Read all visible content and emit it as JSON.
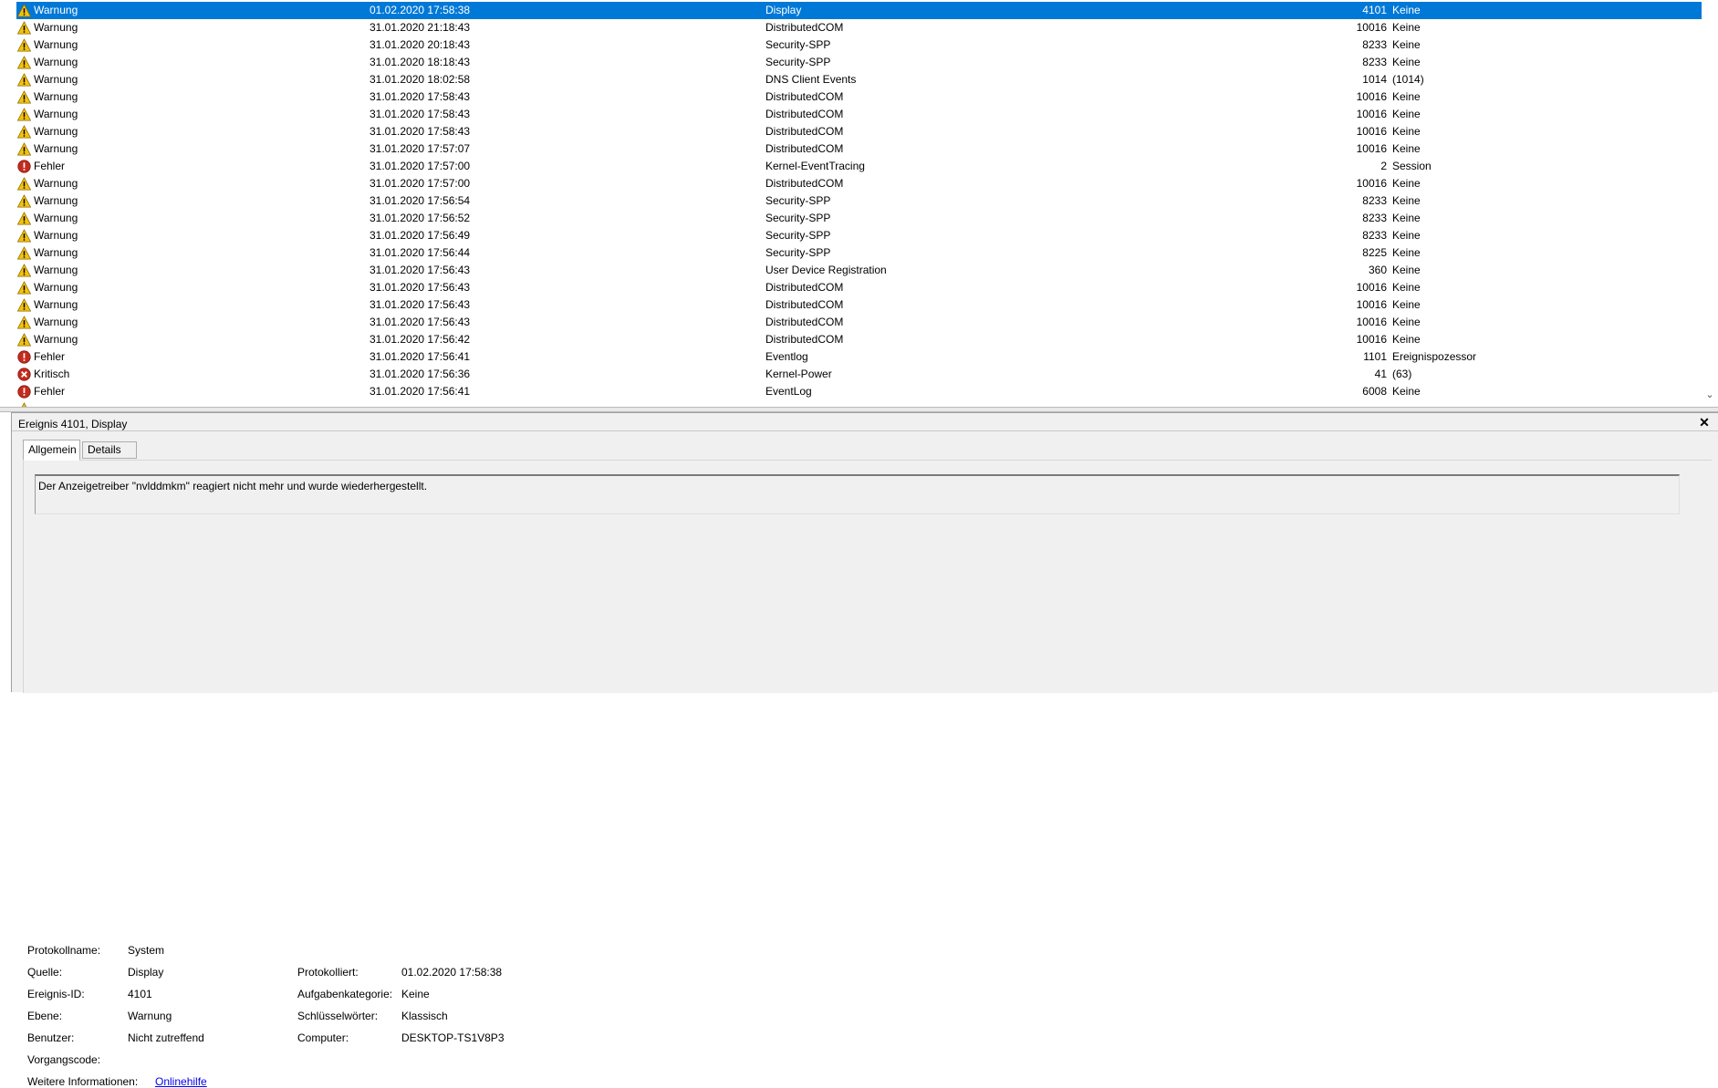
{
  "events": [
    {
      "level": "Warnung",
      "icon": "warning-icon",
      "date": "01.02.2020 17:58:38",
      "source": "Display",
      "id": "4101",
      "task": "Keine",
      "selected": true
    },
    {
      "level": "Warnung",
      "icon": "warning-icon",
      "date": "31.01.2020 21:18:43",
      "source": "DistributedCOM",
      "id": "10016",
      "task": "Keine"
    },
    {
      "level": "Warnung",
      "icon": "warning-icon",
      "date": "31.01.2020 20:18:43",
      "source": "Security-SPP",
      "id": "8233",
      "task": "Keine"
    },
    {
      "level": "Warnung",
      "icon": "warning-icon",
      "date": "31.01.2020 18:18:43",
      "source": "Security-SPP",
      "id": "8233",
      "task": "Keine"
    },
    {
      "level": "Warnung",
      "icon": "warning-icon",
      "date": "31.01.2020 18:02:58",
      "source": "DNS Client Events",
      "id": "1014",
      "task": "(1014)"
    },
    {
      "level": "Warnung",
      "icon": "warning-icon",
      "date": "31.01.2020 17:58:43",
      "source": "DistributedCOM",
      "id": "10016",
      "task": "Keine"
    },
    {
      "level": "Warnung",
      "icon": "warning-icon",
      "date": "31.01.2020 17:58:43",
      "source": "DistributedCOM",
      "id": "10016",
      "task": "Keine"
    },
    {
      "level": "Warnung",
      "icon": "warning-icon",
      "date": "31.01.2020 17:58:43",
      "source": "DistributedCOM",
      "id": "10016",
      "task": "Keine"
    },
    {
      "level": "Warnung",
      "icon": "warning-icon",
      "date": "31.01.2020 17:57:07",
      "source": "DistributedCOM",
      "id": "10016",
      "task": "Keine"
    },
    {
      "level": "Fehler",
      "icon": "error-icon",
      "date": "31.01.2020 17:57:00",
      "source": "Kernel-EventTracing",
      "id": "2",
      "task": "Session"
    },
    {
      "level": "Warnung",
      "icon": "warning-icon",
      "date": "31.01.2020 17:57:00",
      "source": "DistributedCOM",
      "id": "10016",
      "task": "Keine"
    },
    {
      "level": "Warnung",
      "icon": "warning-icon",
      "date": "31.01.2020 17:56:54",
      "source": "Security-SPP",
      "id": "8233",
      "task": "Keine"
    },
    {
      "level": "Warnung",
      "icon": "warning-icon",
      "date": "31.01.2020 17:56:52",
      "source": "Security-SPP",
      "id": "8233",
      "task": "Keine"
    },
    {
      "level": "Warnung",
      "icon": "warning-icon",
      "date": "31.01.2020 17:56:49",
      "source": "Security-SPP",
      "id": "8233",
      "task": "Keine"
    },
    {
      "level": "Warnung",
      "icon": "warning-icon",
      "date": "31.01.2020 17:56:44",
      "source": "Security-SPP",
      "id": "8225",
      "task": "Keine"
    },
    {
      "level": "Warnung",
      "icon": "warning-icon",
      "date": "31.01.2020 17:56:43",
      "source": "User Device Registration",
      "id": "360",
      "task": "Keine"
    },
    {
      "level": "Warnung",
      "icon": "warning-icon",
      "date": "31.01.2020 17:56:43",
      "source": "DistributedCOM",
      "id": "10016",
      "task": "Keine"
    },
    {
      "level": "Warnung",
      "icon": "warning-icon",
      "date": "31.01.2020 17:56:43",
      "source": "DistributedCOM",
      "id": "10016",
      "task": "Keine"
    },
    {
      "level": "Warnung",
      "icon": "warning-icon",
      "date": "31.01.2020 17:56:43",
      "source": "DistributedCOM",
      "id": "10016",
      "task": "Keine"
    },
    {
      "level": "Warnung",
      "icon": "warning-icon",
      "date": "31.01.2020 17:56:42",
      "source": "DistributedCOM",
      "id": "10016",
      "task": "Keine"
    },
    {
      "level": "Fehler",
      "icon": "error-icon",
      "date": "31.01.2020 17:56:41",
      "source": "Eventlog",
      "id": "1101",
      "task": "Ereignispozessor"
    },
    {
      "level": "Kritisch",
      "icon": "critical-icon",
      "date": "31.01.2020 17:56:36",
      "source": "Kernel-Power",
      "id": "41",
      "task": "(63)"
    },
    {
      "level": "Fehler",
      "icon": "error-icon",
      "date": "31.01.2020 17:56:41",
      "source": "EventLog",
      "id": "6008",
      "task": "Keine"
    }
  ],
  "detail": {
    "title": "Ereignis 4101, Display",
    "tabs": {
      "general": "Allgemein",
      "details": "Details"
    },
    "message": "Der Anzeigetreiber \"nvlddmkm\" reagiert nicht mehr und wurde wiederhergestellt.",
    "labels": {
      "log_name": "Protokollname:",
      "source": "Quelle:",
      "event_id": "Ereignis-ID:",
      "level": "Ebene:",
      "user": "Benutzer:",
      "opcode": "Vorgangscode:",
      "more_info": "Weitere Informationen:",
      "logged": "Protokolliert:",
      "task_category": "Aufgabenkategorie:",
      "keywords": "Schlüsselwörter:",
      "computer": "Computer:"
    },
    "values": {
      "log_name": "System",
      "source": "Display",
      "event_id": "4101",
      "level": "Warnung",
      "user": "Nicht zutreffend",
      "opcode": "",
      "logged": "01.02.2020 17:58:38",
      "task_category": "Keine",
      "keywords": "Klassisch",
      "computer": "DESKTOP-TS1V8P3"
    },
    "help_link": "Onlinehilfe"
  },
  "colors": {
    "selection": "#0078d7",
    "warning": "#f4c20d",
    "error": "#c42b1c",
    "link": "#0000ee"
  }
}
